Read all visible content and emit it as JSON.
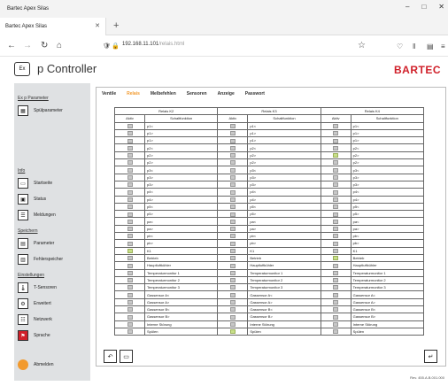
{
  "window": {
    "title": "Bartec Apex Silas",
    "minimize": "–",
    "maximize": "□",
    "close": "✕"
  },
  "tab": {
    "label": "Bartec Apex Silas",
    "close": "✕",
    "new": "+"
  },
  "nav": {
    "back": "←",
    "forward": "→",
    "reload": "↻",
    "home": "⌂",
    "url_host": "192.168.11.101",
    "url_path": "/relais.html",
    "star": "☆"
  },
  "header": {
    "logo": "Ex",
    "title": "p Controller",
    "brand": "BARTEC"
  },
  "sidebar": {
    "section_params": "Ex p Parameter",
    "spuelparameter": "Spülparameter",
    "section_info": "Info",
    "startseite": "Startseite",
    "status": "Status",
    "meldungen": "Meldungen",
    "section_speichern": "Speichern",
    "parameter": "Parameter",
    "fehlerspeicher": "Fehlerspeicher",
    "section_einstellungen": "Einstellungen",
    "t_sensoren": "T-Sensoren",
    "erweitert": "Erweitert",
    "netzwerk": "Netzwerk",
    "sprache": "Sprache",
    "abmelden": "Abmelden"
  },
  "main_tabs": [
    "Ventile",
    "Relais",
    "Melbefehlen",
    "Sensoren",
    "Anzeige",
    "Passwort"
  ],
  "active_tab": 1,
  "relais_groups": [
    {
      "title": "Relais K2",
      "col_aktiv": "Aktiv",
      "col_func": "Schaltfunktion"
    },
    {
      "title": "Relais K3",
      "col_aktiv": "Aktiv",
      "col_func": "Schaltfunktion"
    },
    {
      "title": "Relais K4",
      "col_aktiv": "Aktiv",
      "col_func": "Schaltfunktion"
    }
  ],
  "rows": [
    {
      "label": "p1<",
      "on": [
        false,
        false,
        false
      ]
    },
    {
      "label": "p1>",
      "on": [
        false,
        false,
        false
      ]
    },
    {
      "label": "p1>",
      "on": [
        false,
        false,
        false
      ]
    },
    {
      "label": "p2<",
      "on": [
        false,
        false,
        false
      ]
    },
    {
      "label": "p2>",
      "on": [
        false,
        false,
        true
      ]
    },
    {
      "label": "p2>",
      "on": [
        false,
        false,
        false
      ]
    },
    {
      "label": "p3<",
      "on": [
        false,
        false,
        false
      ]
    },
    {
      "label": "p3>",
      "on": [
        false,
        false,
        false
      ]
    },
    {
      "label": "p3>",
      "on": [
        false,
        false,
        false
      ]
    },
    {
      "label": "p4<",
      "on": [
        false,
        false,
        false
      ]
    },
    {
      "label": "p4>",
      "on": [
        false,
        false,
        false
      ]
    },
    {
      "label": "p5<",
      "on": [
        false,
        false,
        false
      ]
    },
    {
      "label": "p5>",
      "on": [
        false,
        false,
        false
      ]
    },
    {
      "label": "pa<",
      "on": [
        false,
        false,
        false
      ]
    },
    {
      "label": "pa>",
      "on": [
        false,
        false,
        false
      ]
    },
    {
      "label": "pb<",
      "on": [
        false,
        false,
        false
      ]
    },
    {
      "label": "pb>",
      "on": [
        false,
        false,
        false
      ]
    },
    {
      "label": "K1",
      "on": [
        true,
        false,
        false
      ]
    },
    {
      "label": "Betrieb",
      "on": [
        false,
        false,
        true
      ]
    },
    {
      "label": "Hauptluftkühler",
      "on": [
        false,
        false,
        false
      ]
    },
    {
      "label": "Temperaturmonitor 1",
      "on": [
        false,
        false,
        false
      ]
    },
    {
      "label": "Temperaturmonitor 2",
      "on": [
        false,
        false,
        false
      ]
    },
    {
      "label": "Temperaturmonitor 3",
      "on": [
        false,
        false,
        false
      ]
    },
    {
      "label": "Gassensor A<",
      "on": [
        false,
        false,
        false
      ]
    },
    {
      "label": "Gassensor A>",
      "on": [
        false,
        false,
        false
      ]
    },
    {
      "label": "Gassensor B<",
      "on": [
        false,
        false,
        false
      ]
    },
    {
      "label": "Gassensor B>",
      "on": [
        false,
        false,
        false
      ]
    },
    {
      "label": "Interne Störung",
      "on": [
        false,
        false,
        false
      ]
    },
    {
      "label": "Spülen",
      "on": [
        false,
        true,
        false
      ]
    }
  ],
  "version": "Rev. 455.A.B.001.000"
}
